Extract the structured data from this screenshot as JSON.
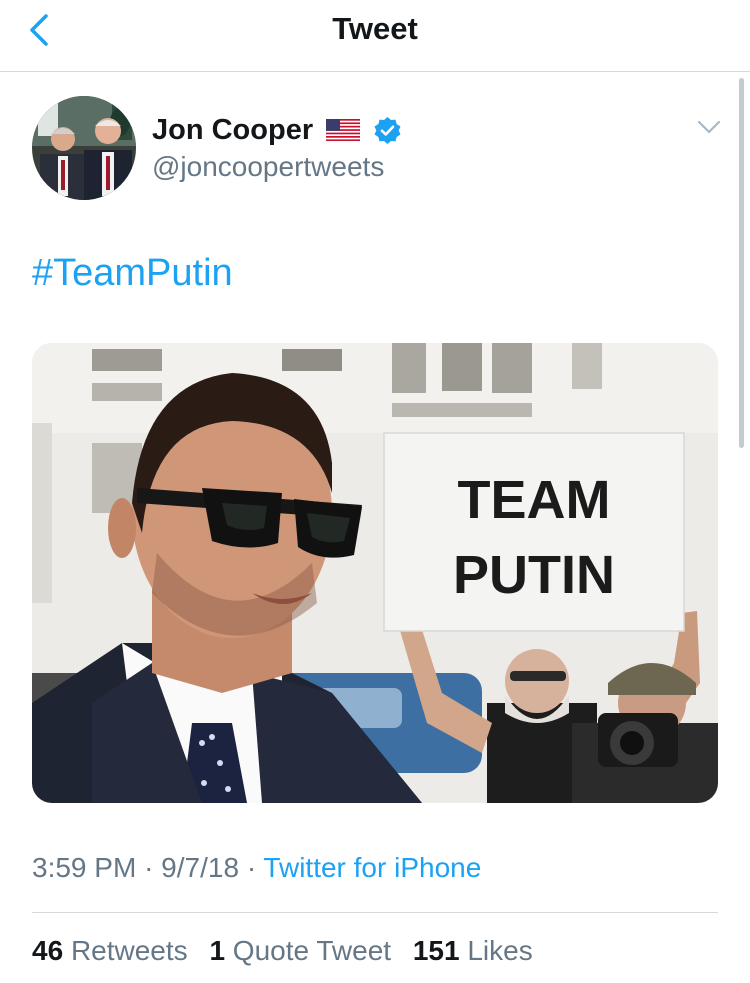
{
  "nav": {
    "title": "Tweet"
  },
  "tweet": {
    "author_name": "Jon Cooper",
    "author_handle": "@joncoopertweets",
    "text": "#TeamPutin",
    "sign_text_line1": "TEAM",
    "sign_text_line2": "PUTIN",
    "time": "3:59 PM",
    "date": "9/7/18",
    "separator": "·",
    "source": "Twitter for iPhone"
  },
  "stats": {
    "retweets_count": "46",
    "retweets_label": "Retweets",
    "quotes_count": "1",
    "quotes_label": "Quote Tweet",
    "likes_count": "151",
    "likes_label": "Likes"
  },
  "icons": {
    "back": "chevron-left-icon",
    "flag": "us-flag-icon",
    "verified": "verified-badge-icon",
    "more": "chevron-down-icon"
  },
  "colors": {
    "accent": "#1da1f2",
    "text_primary": "#14171a",
    "text_secondary": "#657786",
    "divider": "#d6d9dc"
  }
}
